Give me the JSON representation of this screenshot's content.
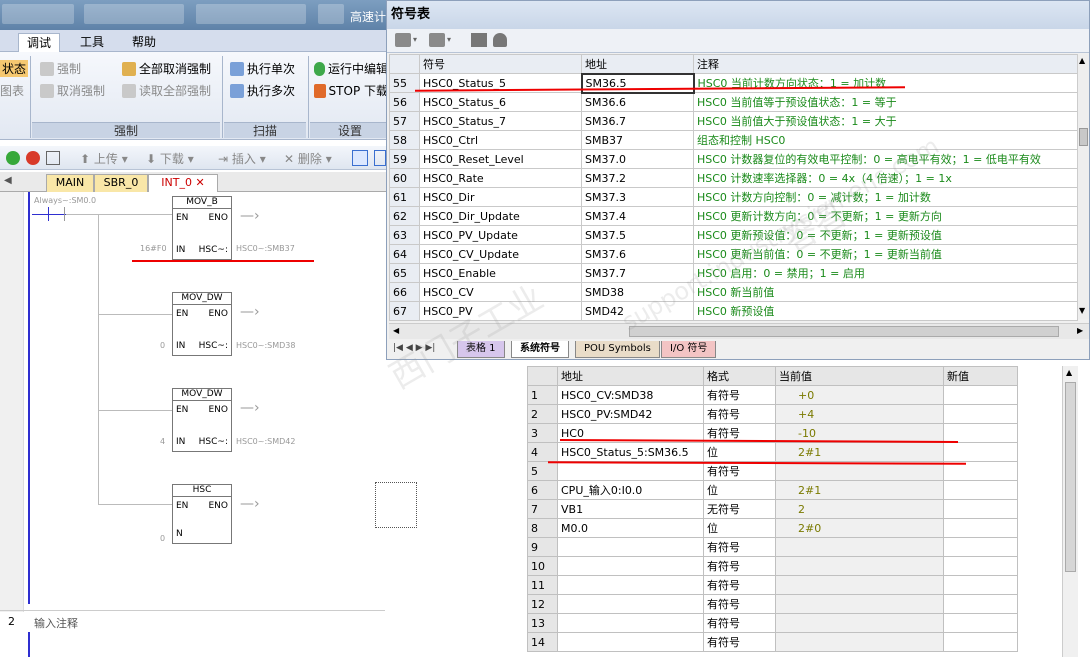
{
  "app": {
    "title": "高速计"
  },
  "ribbon": {
    "tabs": [
      "调试",
      "工具",
      "帮助"
    ],
    "left_cut": [
      "状态",
      "图表"
    ],
    "force": {
      "force": "强制",
      "unforce": "取消强制",
      "unforce_all": "全部取消强制",
      "read_all_forced": "读取全部强制",
      "label": "强制"
    },
    "scan": {
      "single": "执行单次",
      "multi": "执行多次",
      "label": "扫描"
    },
    "settings": {
      "run_edit": "运行中编辑",
      "stop_download": "STOP 下载",
      "label": "设置"
    }
  },
  "toolbar": {
    "upload": "上传",
    "download": "下载",
    "insert": "插入",
    "delete": "删除"
  },
  "editor": {
    "tabs": [
      "MAIN",
      "SBR_0",
      "INT_0"
    ],
    "contact_label": "Always~:SM0.0",
    "blocks": [
      {
        "title": "MOV_B",
        "en": "EN",
        "eno": "ENO",
        "in_label": "IN",
        "out_label": "HSC~:",
        "in_value": "16#F0",
        "out_value": "HSC0~:SMB37"
      },
      {
        "title": "MOV_DW",
        "en": "EN",
        "eno": "ENO",
        "in_label": "IN",
        "out_label": "HSC~:",
        "in_value": "0",
        "out_value": "HSC0~:SMD38"
      },
      {
        "title": "MOV_DW",
        "en": "EN",
        "eno": "ENO",
        "in_label": "IN",
        "out_label": "HSC~:",
        "in_value": "4",
        "out_value": "HSC0~:SMD42"
      },
      {
        "title": "HSC",
        "en": "EN",
        "eno": "ENO",
        "in_label": "N",
        "out_label": "",
        "in_value": "0",
        "out_value": ""
      }
    ],
    "network2_num": "2",
    "network2_comment": "输入注释"
  },
  "symbol_table": {
    "title": "符号表",
    "headers": [
      "",
      "符号",
      "地址",
      "注释"
    ],
    "rows": [
      {
        "num": "55",
        "symbol": "HSC0_Status_5",
        "address": "SM36.5",
        "comment": "HSC0 当前计数方向状态：1 = 加计数"
      },
      {
        "num": "56",
        "symbol": "HSC0_Status_6",
        "address": "SM36.6",
        "comment": "HSC0 当前值等于预设值状态：1 = 等于"
      },
      {
        "num": "57",
        "symbol": "HSC0_Status_7",
        "address": "SM36.7",
        "comment": "HSC0 当前值大于预设值状态：1 = 大于"
      },
      {
        "num": "58",
        "symbol": "HSC0_Ctrl",
        "address": "SMB37",
        "comment": "组态和控制 HSC0"
      },
      {
        "num": "59",
        "symbol": "HSC0_Reset_Level",
        "address": "SM37.0",
        "comment": "HSC0 计数器复位的有效电平控制：0 = 高电平有效；1 = 低电平有效"
      },
      {
        "num": "60",
        "symbol": "HSC0_Rate",
        "address": "SM37.2",
        "comment": "HSC0 计数速率选择器：0 = 4x（4 倍速）；1 = 1x"
      },
      {
        "num": "61",
        "symbol": "HSC0_Dir",
        "address": "SM37.3",
        "comment": "HSC0 计数方向控制：0 = 减计数；1 = 加计数"
      },
      {
        "num": "62",
        "symbol": "HSC0_Dir_Update",
        "address": "SM37.4",
        "comment": "HSC0 更新计数方向：0 = 不更新；1 = 更新方向"
      },
      {
        "num": "63",
        "symbol": "HSC0_PV_Update",
        "address": "SM37.5",
        "comment": "HSC0 更新预设值：0 = 不更新；1 = 更新预设值"
      },
      {
        "num": "64",
        "symbol": "HSC0_CV_Update",
        "address": "SM37.6",
        "comment": "HSC0 更新当前值：0 = 不更新；1 = 更新当前值"
      },
      {
        "num": "65",
        "symbol": "HSC0_Enable",
        "address": "SM37.7",
        "comment": "HSC0 启用：0 = 禁用；1 = 启用"
      },
      {
        "num": "66",
        "symbol": "HSC0_CV",
        "address": "SMD38",
        "comment": "HSC0 新当前值"
      },
      {
        "num": "67",
        "symbol": "HSC0_PV",
        "address": "SMD42",
        "comment": "HSC0 新预设值"
      }
    ],
    "sheet_tabs": [
      "表格 1",
      "系统符号",
      "POU Symbols",
      "I/O 符号"
    ],
    "active_sheet": "系统符号"
  },
  "status_chart": {
    "headers": [
      "",
      "地址",
      "格式",
      "当前值",
      "新值"
    ],
    "rows": [
      {
        "num": "1",
        "address": "HSC0_CV:SMD38",
        "format": "有符号",
        "value": "+0",
        "new": ""
      },
      {
        "num": "2",
        "address": "HSC0_PV:SMD42",
        "format": "有符号",
        "value": "+4",
        "new": ""
      },
      {
        "num": "3",
        "address": "HC0",
        "format": "有符号",
        "value": "-10",
        "new": ""
      },
      {
        "num": "4",
        "address": "HSC0_Status_5:SM36.5",
        "format": "位",
        "value": "2#1",
        "new": ""
      },
      {
        "num": "5",
        "address": "",
        "format": "有符号",
        "value": "",
        "new": ""
      },
      {
        "num": "6",
        "address": "CPU_输入0:I0.0",
        "format": "位",
        "value": "2#1",
        "new": ""
      },
      {
        "num": "7",
        "address": "VB1",
        "format": "无符号",
        "value": "2",
        "new": ""
      },
      {
        "num": "8",
        "address": "M0.0",
        "format": "位",
        "value": "2#0",
        "new": ""
      },
      {
        "num": "9",
        "address": "",
        "format": "有符号",
        "value": "",
        "new": ""
      },
      {
        "num": "10",
        "address": "",
        "format": "有符号",
        "value": "",
        "new": ""
      },
      {
        "num": "11",
        "address": "",
        "format": "有符号",
        "value": "",
        "new": ""
      },
      {
        "num": "12",
        "address": "",
        "format": "有符号",
        "value": "",
        "new": ""
      },
      {
        "num": "13",
        "address": "",
        "format": "有符号",
        "value": "",
        "new": ""
      },
      {
        "num": "14",
        "address": "",
        "format": "有符号",
        "value": "",
        "new": ""
      }
    ]
  },
  "colors": {
    "comment_green": "#1a8a1a",
    "annotation_red": "#e00000",
    "rail_blue": "#2f2fd0",
    "value_olive": "#7a7a00"
  }
}
